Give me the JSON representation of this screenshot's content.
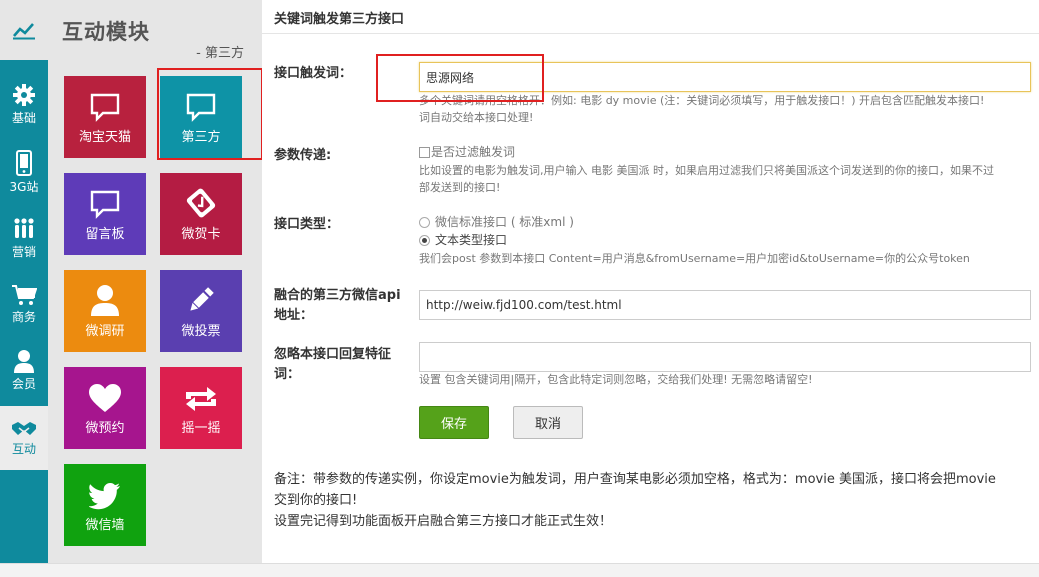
{
  "rail": {
    "items": [
      {
        "label": "基础",
        "icon": "gear-icon"
      },
      {
        "label": "3G站",
        "icon": "phone-icon"
      },
      {
        "label": "营销",
        "icon": "people-icon"
      },
      {
        "label": "商务",
        "icon": "cart-icon"
      },
      {
        "label": "会员",
        "icon": "user-icon"
      },
      {
        "label": "互动",
        "icon": "handshake-icon",
        "active": true
      }
    ]
  },
  "panel": {
    "title": "互动模块",
    "subtitle": "- 第三方",
    "tiles": [
      {
        "label": "淘宝天猫",
        "icon": "speech-bubble-icon",
        "color": "#b8213e"
      },
      {
        "label": "第三方",
        "icon": "speech-bubble-icon",
        "color": "#0e93a6",
        "selected": true
      },
      {
        "label": "留言板",
        "icon": "speech-bubble-icon",
        "color": "#5e3bb8"
      },
      {
        "label": "微贺卡",
        "icon": "card-stack-icon",
        "color": "#b41c43"
      },
      {
        "label": "微调研",
        "icon": "user-icon",
        "color": "#ec8b0f"
      },
      {
        "label": "微投票",
        "icon": "pencil-icon",
        "color": "#5a3fb0"
      },
      {
        "label": "微预约",
        "icon": "heart-icon",
        "color": "#a6158e"
      },
      {
        "label": "摇一摇",
        "icon": "retweet-icon",
        "color": "#dc1f4e"
      },
      {
        "label": "微信墙",
        "icon": "twitter-bird-icon",
        "color": "#10a20f"
      }
    ]
  },
  "main": {
    "title": "关键词触发第三方接口",
    "keyword": {
      "label": "接口触发词：",
      "value": "思源网络",
      "help1": "多个关键词请用空格格开：例如: 电影  dy  movie (注：关键词必须填写，用于触发接口！) 开启包含匹配触发本接口!",
      "help2": "词自动交给本接口处理!"
    },
    "param": {
      "label": "参数传递:",
      "checkbox_label": "是否过滤触发词",
      "help1": "比如设置的电影为触发词,用户输入 电影 美国派 时，如果启用过滤我们只将美国派这个词发送到的你的接口，如果不过",
      "help2": "部发送到的接口!"
    },
    "type": {
      "label": "接口类型：",
      "option1": "微信标准接口 ( 标准xml )",
      "option2": "文本类型接口",
      "help": "我们会post 参数到本接口 Content=用户消息&fromUsername=用户加密id&toUsername=你的公众号token"
    },
    "api": {
      "label_line1": "融合的第三方微信api",
      "label_line2": "地址：",
      "value": "http://weiw.fjd100.com/test.html"
    },
    "ignore": {
      "label_line1": "忽略本接口回复特征",
      "label_line2": "词：",
      "value": "",
      "help": "设置 包含关键词用|隔开，包含此特定词则忽略，交给我们处理! 无需忽略请留空!"
    },
    "buttons": {
      "save": "保存",
      "cancel": "取消"
    },
    "note": {
      "line1": "备注：带参数的传递实例，你设定movie为触发词，用户查询某电影必须加空格，格式为：movie 美国派，接口将会把movie",
      "line2": "交到你的接口!",
      "line3": "设置完记得到功能面板开启融合第三方接口才能正式生效！"
    }
  },
  "colors": {
    "rail": "#0f8a9d",
    "panel_bg": "#e6e6e6",
    "highlight_box": "#e02020",
    "save_button": "#55a21a"
  }
}
